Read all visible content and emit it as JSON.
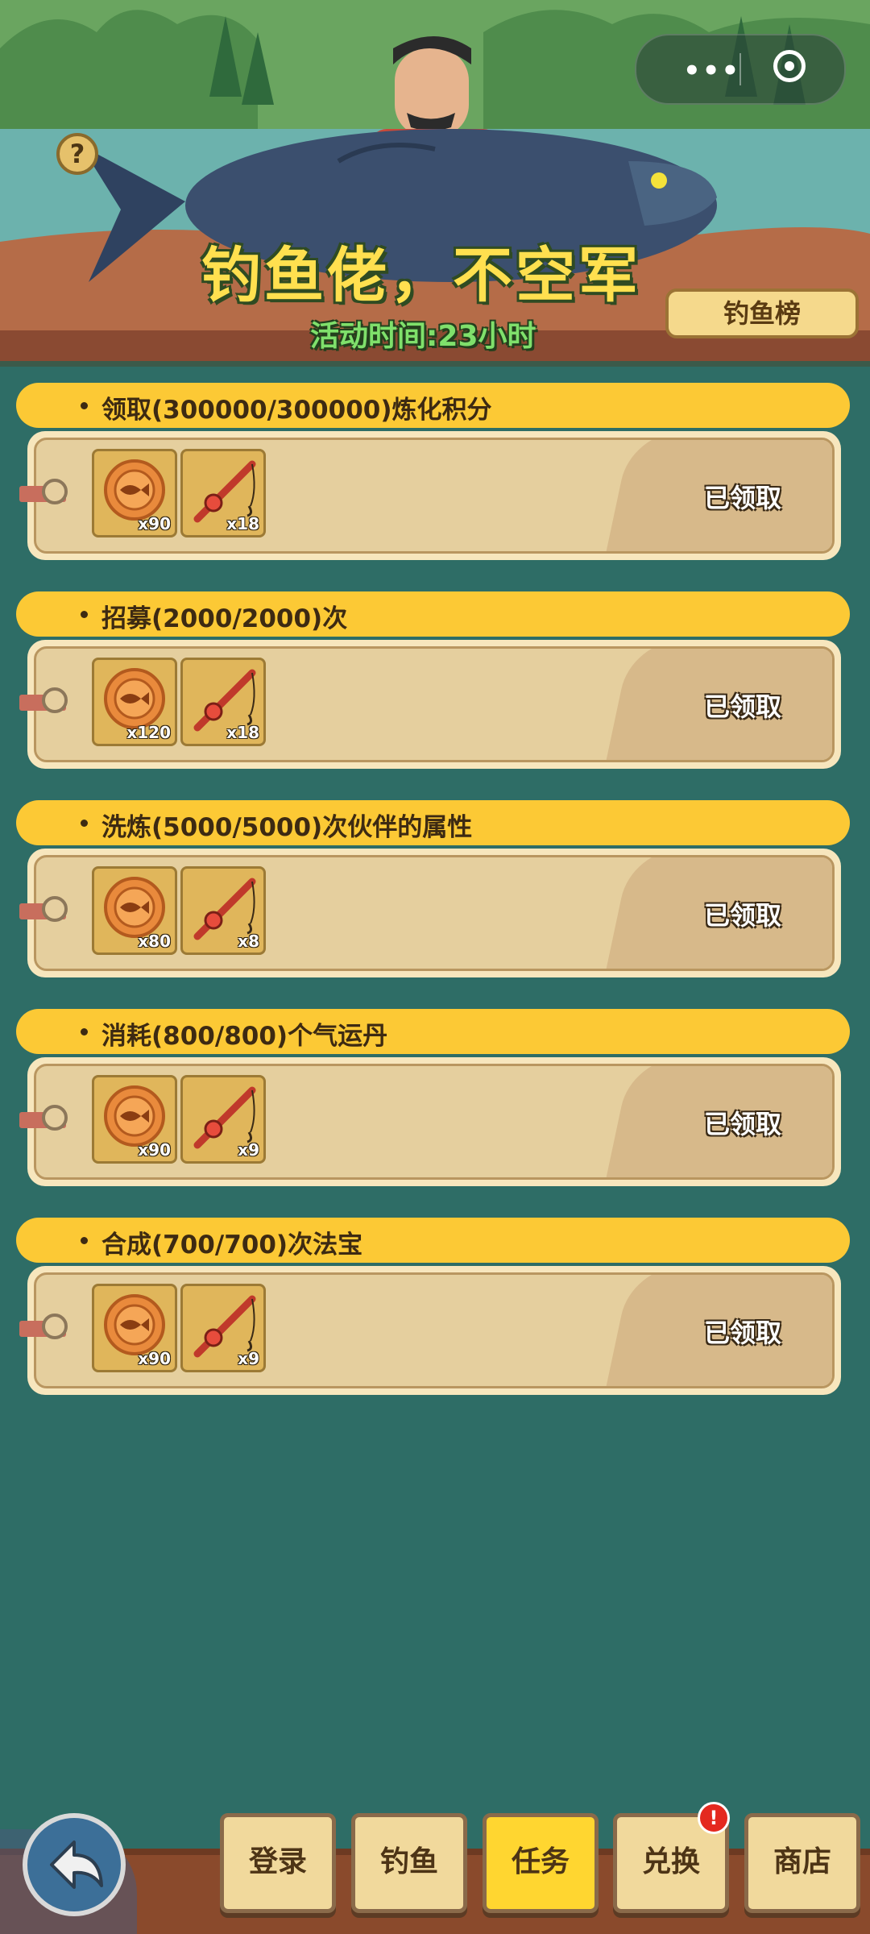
{
  "header": {
    "title": "钓鱼佬，不空军",
    "timer": "活动时间:23小时",
    "rank_button": "钓鱼榜",
    "help_label": "?",
    "menu_icon": "more-dots-icon",
    "close_icon": "target-circle-icon"
  },
  "tasks": [
    {
      "title": "领取(300000/300000)炼化积分",
      "rewards": [
        {
          "icon": "fish-coin-icon",
          "count": "x90"
        },
        {
          "icon": "fishing-rod-icon",
          "count": "x18"
        }
      ],
      "status": "已领取"
    },
    {
      "title": "招募(2000/2000)次",
      "rewards": [
        {
          "icon": "fish-coin-icon",
          "count": "x120"
        },
        {
          "icon": "fishing-rod-icon",
          "count": "x18"
        }
      ],
      "status": "已领取"
    },
    {
      "title": "洗炼(5000/5000)次伙伴的属性",
      "rewards": [
        {
          "icon": "fish-coin-icon",
          "count": "x80"
        },
        {
          "icon": "fishing-rod-icon",
          "count": "x8"
        }
      ],
      "status": "已领取"
    },
    {
      "title": "消耗(800/800)个气运丹",
      "rewards": [
        {
          "icon": "fish-coin-icon",
          "count": "x90"
        },
        {
          "icon": "fishing-rod-icon",
          "count": "x9"
        }
      ],
      "status": "已领取"
    },
    {
      "title": "合成(700/700)次法宝",
      "rewards": [
        {
          "icon": "fish-coin-icon",
          "count": "x90"
        },
        {
          "icon": "fishing-rod-icon",
          "count": "x9"
        }
      ],
      "status": "已领取"
    }
  ],
  "nav": {
    "items": [
      {
        "label": "登录"
      },
      {
        "label": "钓鱼"
      },
      {
        "label": "任务",
        "active": true
      },
      {
        "label": "兑换",
        "badge": "!"
      },
      {
        "label": "商店"
      }
    ],
    "back_icon": "back-arrow-icon"
  },
  "colors": {
    "background": "#2e6d66",
    "header_strip": "#fcc935",
    "active_tab": "#ffd630",
    "title": "#ffe04f",
    "timer": "#7fe06b"
  }
}
